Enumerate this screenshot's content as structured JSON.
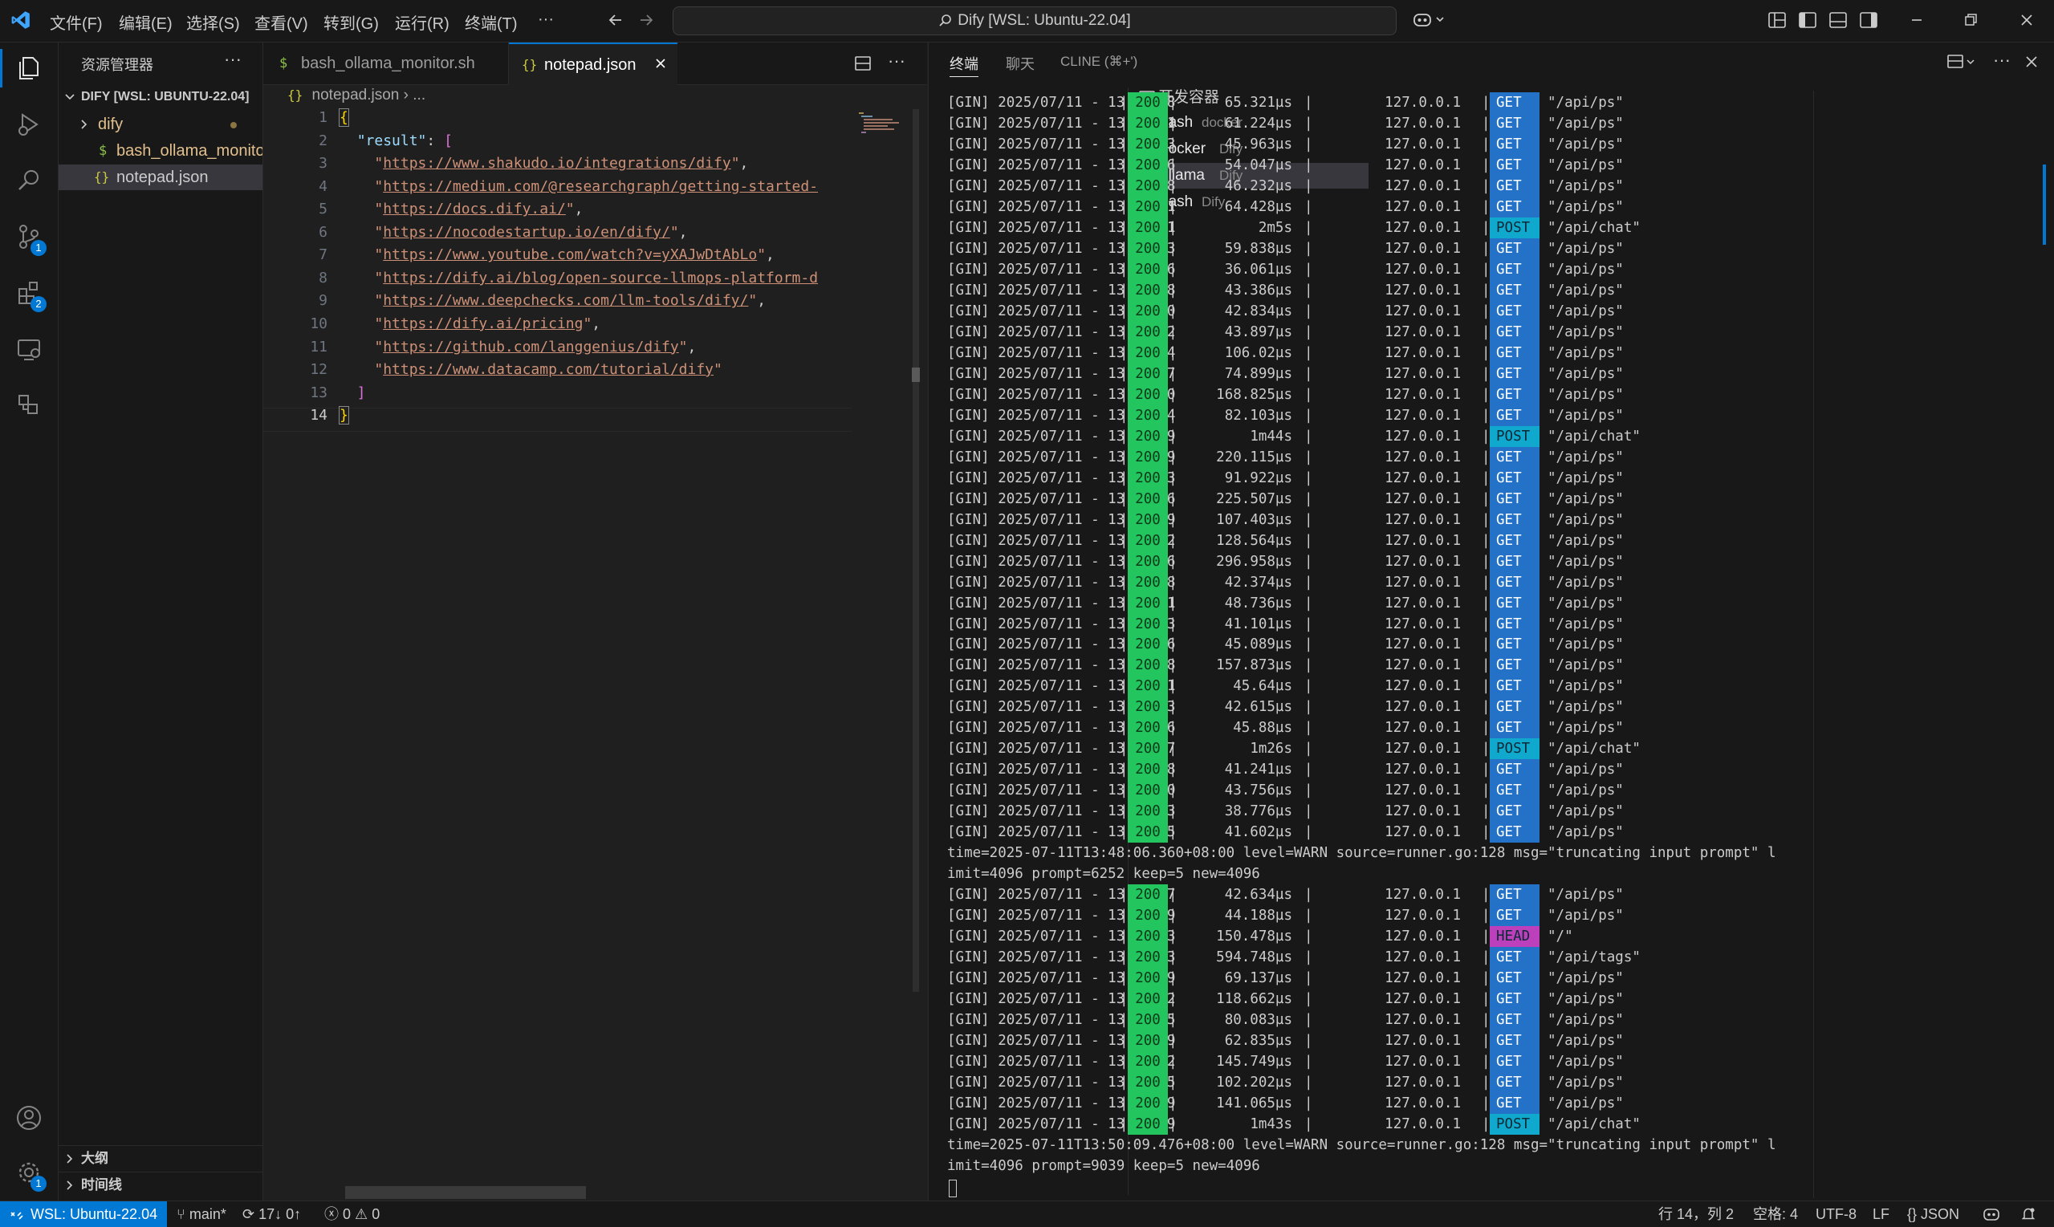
{
  "titlebar": {
    "menus": [
      "文件(F)",
      "编辑(E)",
      "选择(S)",
      "查看(V)",
      "转到(G)",
      "运行(R)",
      "终端(T)",
      "···"
    ],
    "command_center": "Dify [WSL: Ubuntu-22.04]"
  },
  "activity": {
    "scm_badge": "1",
    "extensions_badge": "2",
    "settings_badge": "1"
  },
  "explorer": {
    "title": "资源管理器",
    "root": "DIFY [WSL: UBUNTU-22.04]",
    "items": [
      {
        "icon": "chevron-right",
        "label": "dify",
        "type": "folder"
      },
      {
        "icon": "$",
        "label": "bash_ollama_monitor....",
        "type": "file"
      },
      {
        "icon": "{}",
        "label": "notepad.json",
        "type": "file"
      }
    ],
    "outline": "大纲",
    "timeline": "时间线"
  },
  "editor": {
    "tabs": [
      {
        "icon": "$",
        "label": "bash_ollama_monitor.sh"
      },
      {
        "icon": "{}",
        "label": "notepad.json"
      }
    ],
    "breadcrumb": [
      "notepad.json",
      "..."
    ],
    "lines": [
      {
        "n": "1",
        "t": "{",
        "k": "br1"
      },
      {
        "n": "2",
        "t": "  \"result\": [",
        "k": "key"
      },
      {
        "n": "3",
        "t": "    \"https://www.shakudo.io/integrations/dify\",",
        "k": "str"
      },
      {
        "n": "4",
        "t": "    \"https://medium.com/@researchgraph/getting-started-",
        "k": "str"
      },
      {
        "n": "5",
        "t": "    \"https://docs.dify.ai/\",",
        "k": "str"
      },
      {
        "n": "6",
        "t": "    \"https://nocodestartup.io/en/dify/\",",
        "k": "str"
      },
      {
        "n": "7",
        "t": "    \"https://www.youtube.com/watch?v=yXAJwDtAbLo\",",
        "k": "str"
      },
      {
        "n": "8",
        "t": "    \"https://dify.ai/blog/open-source-llmops-platform-d",
        "k": "str"
      },
      {
        "n": "9",
        "t": "    \"https://www.deepchecks.com/llm-tools/dify/\",",
        "k": "str"
      },
      {
        "n": "10",
        "t": "    \"https://dify.ai/pricing\",",
        "k": "str"
      },
      {
        "n": "11",
        "t": "    \"https://github.com/langgenius/dify\",",
        "k": "str"
      },
      {
        "n": "12",
        "t": "    \"https://www.datacamp.com/tutorial/dify\"",
        "k": "str"
      },
      {
        "n": "13",
        "t": "  ]",
        "k": "br2"
      },
      {
        "n": "14",
        "t": "}",
        "k": "br1"
      }
    ]
  },
  "panel": {
    "tabs": [
      "终端",
      "聊天",
      "CLINE (⌘+')"
    ],
    "terminals_title": "开发容器",
    "terminals": [
      {
        "name": "bash",
        "detail": "docker"
      },
      {
        "name": "docker",
        "detail": "Dify"
      },
      {
        "name": "ollama",
        "detail": "Dify"
      },
      {
        "name": "bash",
        "detail": "Dify"
      }
    ]
  },
  "log": [
    {
      "ts": "13:44:18",
      "st": "200",
      "lat": "65.321µs",
      "ip": "127.0.0.1",
      "m": "GET",
      "p": "\"/api/ps\""
    },
    {
      "ts": "13:44:21",
      "st": "200",
      "lat": "61.224µs",
      "ip": "127.0.0.1",
      "m": "GET",
      "p": "\"/api/ps\""
    },
    {
      "ts": "13:44:23",
      "st": "200",
      "lat": "45.963µs",
      "ip": "127.0.0.1",
      "m": "GET",
      "p": "\"/api/ps\""
    },
    {
      "ts": "13:44:26",
      "st": "200",
      "lat": "54.047µs",
      "ip": "127.0.0.1",
      "m": "GET",
      "p": "\"/api/ps\""
    },
    {
      "ts": "13:44:28",
      "st": "200",
      "lat": "46.232µs",
      "ip": "127.0.0.1",
      "m": "GET",
      "p": "\"/api/ps\""
    },
    {
      "ts": "13:44:31",
      "st": "200",
      "lat": "64.428µs",
      "ip": "127.0.0.1",
      "m": "GET",
      "p": "\"/api/ps\""
    },
    {
      "ts": "13:44:31",
      "st": "200",
      "lat": "2m5s",
      "ip": "127.0.0.1",
      "m": "POST",
      "p": "\"/api/chat\""
    },
    {
      "ts": "13:44:33",
      "st": "200",
      "lat": "59.838µs",
      "ip": "127.0.0.1",
      "m": "GET",
      "p": "\"/api/ps\""
    },
    {
      "ts": "13:44:36",
      "st": "200",
      "lat": "36.061µs",
      "ip": "127.0.0.1",
      "m": "GET",
      "p": "\"/api/ps\""
    },
    {
      "ts": "13:44:38",
      "st": "200",
      "lat": "43.386µs",
      "ip": "127.0.0.1",
      "m": "GET",
      "p": "\"/api/ps\""
    },
    {
      "ts": "13:44:40",
      "st": "200",
      "lat": "42.834µs",
      "ip": "127.0.0.1",
      "m": "GET",
      "p": "\"/api/ps\""
    },
    {
      "ts": "13:44:42",
      "st": "200",
      "lat": "43.897µs",
      "ip": "127.0.0.1",
      "m": "GET",
      "p": "\"/api/ps\""
    },
    {
      "ts": "13:45:54",
      "st": "200",
      "lat": "106.02µs",
      "ip": "127.0.0.1",
      "m": "GET",
      "p": "\"/api/ps\""
    },
    {
      "ts": "13:45:57",
      "st": "200",
      "lat": "74.899µs",
      "ip": "127.0.0.1",
      "m": "GET",
      "p": "\"/api/ps\""
    },
    {
      "ts": "13:46:00",
      "st": "200",
      "lat": "168.825µs",
      "ip": "127.0.0.1",
      "m": "GET",
      "p": "\"/api/ps\""
    },
    {
      "ts": "13:46:04",
      "st": "200",
      "lat": "82.103µs",
      "ip": "127.0.0.1",
      "m": "GET",
      "p": "\"/api/ps\""
    },
    {
      "ts": "13:46:29",
      "st": "200",
      "lat": "1m44s",
      "ip": "127.0.0.1",
      "m": "POST",
      "p": "\"/api/chat\""
    },
    {
      "ts": "13:47:19",
      "st": "200",
      "lat": "220.115µs",
      "ip": "127.0.0.1",
      "m": "GET",
      "p": "\"/api/ps\""
    },
    {
      "ts": "13:47:23",
      "st": "200",
      "lat": "91.922µs",
      "ip": "127.0.0.1",
      "m": "GET",
      "p": "\"/api/ps\""
    },
    {
      "ts": "13:47:26",
      "st": "200",
      "lat": "225.507µs",
      "ip": "127.0.0.1",
      "m": "GET",
      "p": "\"/api/ps\""
    },
    {
      "ts": "13:47:29",
      "st": "200",
      "lat": "107.403µs",
      "ip": "127.0.0.1",
      "m": "GET",
      "p": "\"/api/ps\""
    },
    {
      "ts": "13:47:32",
      "st": "200",
      "lat": "128.564µs",
      "ip": "127.0.0.1",
      "m": "GET",
      "p": "\"/api/ps\""
    },
    {
      "ts": "13:47:36",
      "st": "200",
      "lat": "296.958µs",
      "ip": "127.0.0.1",
      "m": "GET",
      "p": "\"/api/ps\""
    },
    {
      "ts": "13:47:38",
      "st": "200",
      "lat": "42.374µs",
      "ip": "127.0.0.1",
      "m": "GET",
      "p": "\"/api/ps\""
    },
    {
      "ts": "13:47:41",
      "st": "200",
      "lat": "48.736µs",
      "ip": "127.0.0.1",
      "m": "GET",
      "p": "\"/api/ps\""
    },
    {
      "ts": "13:47:43",
      "st": "200",
      "lat": "41.101µs",
      "ip": "127.0.0.1",
      "m": "GET",
      "p": "\"/api/ps\""
    },
    {
      "ts": "13:47:46",
      "st": "200",
      "lat": "45.089µs",
      "ip": "127.0.0.1",
      "m": "GET",
      "p": "\"/api/ps\""
    },
    {
      "ts": "13:47:48",
      "st": "200",
      "lat": "157.873µs",
      "ip": "127.0.0.1",
      "m": "GET",
      "p": "\"/api/ps\""
    },
    {
      "ts": "13:47:51",
      "st": "200",
      "lat": "45.64µs",
      "ip": "127.0.0.1",
      "m": "GET",
      "p": "\"/api/ps\""
    },
    {
      "ts": "13:47:53",
      "st": "200",
      "lat": "42.615µs",
      "ip": "127.0.0.1",
      "m": "GET",
      "p": "\"/api/ps\""
    },
    {
      "ts": "13:47:56",
      "st": "200",
      "lat": "45.88µs",
      "ip": "127.0.0.1",
      "m": "GET",
      "p": "\"/api/ps\""
    },
    {
      "ts": "13:47:57",
      "st": "200",
      "lat": "1m26s",
      "ip": "127.0.0.1",
      "m": "POST",
      "p": "\"/api/chat\""
    },
    {
      "ts": "13:47:58",
      "st": "200",
      "lat": "41.241µs",
      "ip": "127.0.0.1",
      "m": "GET",
      "p": "\"/api/ps\""
    },
    {
      "ts": "13:48:00",
      "st": "200",
      "lat": "43.756µs",
      "ip": "127.0.0.1",
      "m": "GET",
      "p": "\"/api/ps\""
    },
    {
      "ts": "13:48:03",
      "st": "200",
      "lat": "38.776µs",
      "ip": "127.0.0.1",
      "m": "GET",
      "p": "\"/api/ps\""
    },
    {
      "ts": "13:48:05",
      "st": "200",
      "lat": "41.602µs",
      "ip": "127.0.0.1",
      "m": "GET",
      "p": "\"/api/ps\""
    },
    {
      "raw": "time=2025-07-11T13:48:06.360+08:00 level=WARN source=runner.go:128 msg=\"truncating input prompt\" l"
    },
    {
      "raw": "imit=4096 prompt=6252 keep=5 new=4096"
    },
    {
      "ts": "13:48:07",
      "st": "200",
      "lat": "42.634µs",
      "ip": "127.0.0.1",
      "m": "GET",
      "p": "\"/api/ps\""
    },
    {
      "ts": "13:48:09",
      "st": "200",
      "lat": "44.188µs",
      "ip": "127.0.0.1",
      "m": "GET",
      "p": "\"/api/ps\""
    },
    {
      "ts": "13:48:13",
      "st": "200",
      "lat": "150.478µs",
      "ip": "127.0.0.1",
      "m": "HEAD",
      "p": "\"/\""
    },
    {
      "ts": "13:48:13",
      "st": "200",
      "lat": "594.748µs",
      "ip": "127.0.0.1",
      "m": "GET",
      "p": "\"/api/tags\""
    },
    {
      "ts": "13:48:49",
      "st": "200",
      "lat": "69.137µs",
      "ip": "127.0.0.1",
      "m": "GET",
      "p": "\"/api/ps\""
    },
    {
      "ts": "13:48:52",
      "st": "200",
      "lat": "118.662µs",
      "ip": "127.0.0.1",
      "m": "GET",
      "p": "\"/api/ps\""
    },
    {
      "ts": "13:48:55",
      "st": "200",
      "lat": "80.083µs",
      "ip": "127.0.0.1",
      "m": "GET",
      "p": "\"/api/ps\""
    },
    {
      "ts": "13:48:59",
      "st": "200",
      "lat": "62.835µs",
      "ip": "127.0.0.1",
      "m": "GET",
      "p": "\"/api/ps\""
    },
    {
      "ts": "13:49:02",
      "st": "200",
      "lat": "145.749µs",
      "ip": "127.0.0.1",
      "m": "GET",
      "p": "\"/api/ps\""
    },
    {
      "ts": "13:49:05",
      "st": "200",
      "lat": "102.202µs",
      "ip": "127.0.0.1",
      "m": "GET",
      "p": "\"/api/ps\""
    },
    {
      "ts": "13:49:09",
      "st": "200",
      "lat": "141.065µs",
      "ip": "127.0.0.1",
      "m": "GET",
      "p": "\"/api/ps\""
    },
    {
      "ts": "13:49:49",
      "st": "200",
      "lat": "1m43s",
      "ip": "127.0.0.1",
      "m": "POST",
      "p": "\"/api/chat\""
    },
    {
      "raw": "time=2025-07-11T13:50:09.476+08:00 level=WARN source=runner.go:128 msg=\"truncating input prompt\" l"
    },
    {
      "raw": "imit=4096 prompt=9039 keep=5 new=4096"
    }
  ],
  "log_prefix": "[GIN] 2025/07/11 - ",
  "log_sep": "|",
  "statusbar": {
    "remote": "WSL: Ubuntu-22.04",
    "branch": "main*",
    "sync": "17↓ 0↑",
    "errors": "0",
    "warnings": "0",
    "position": "行 14，列 2",
    "spaces": "空格: 4",
    "encoding": "UTF-8",
    "eol": "LF",
    "language": "JSON"
  },
  "colors": {
    "status_ok": "#23c55e",
    "method_get": "#2472c8",
    "method_post": "#11a8cd",
    "method_head": "#bc3fbc",
    "accent": "#0078d4"
  }
}
